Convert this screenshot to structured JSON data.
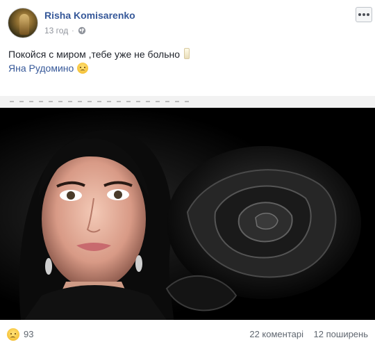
{
  "post": {
    "author": "Risha Komisarenko",
    "time": "13 год",
    "separator": "·",
    "text": "Покойся с миром ,тебе уже не больно",
    "mention": "Яна Рудомино",
    "icons": {
      "avatar": "avatar",
      "privacy": "globe-icon",
      "more": "more-options-icon",
      "candle": "candle-icon",
      "emoji": "sad-emoji-icon"
    }
  },
  "footer": {
    "reaction_icon": "sad-reaction-icon",
    "reaction_count": "93",
    "comments": "22 коментарі",
    "shares": "12 поширень"
  },
  "colors": {
    "link": "#365899",
    "meta": "#90949c",
    "photo_bg": "#000000"
  }
}
